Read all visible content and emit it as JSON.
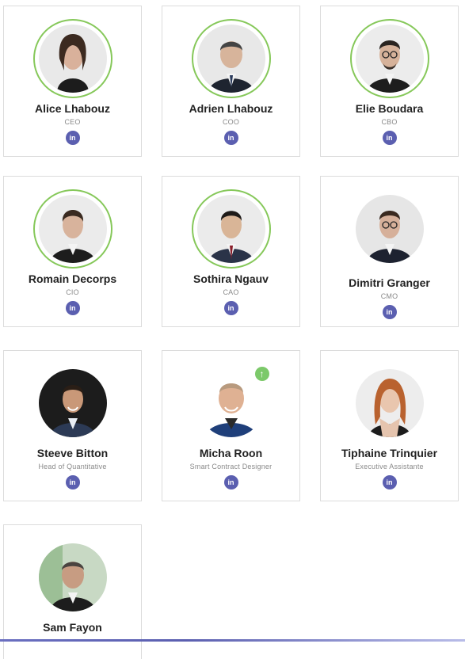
{
  "team": [
    {
      "name": "Alice Lhabouz",
      "role": "CEO",
      "linkedin": "in"
    },
    {
      "name": "Adrien Lhabouz",
      "role": "COO",
      "linkedin": "in"
    },
    {
      "name": "Elie Boudara",
      "role": "CBO",
      "linkedin": "in"
    },
    {
      "name": "Romain Decorps",
      "role": "CIO",
      "linkedin": "in"
    },
    {
      "name": "Sothira Ngauv",
      "role": "CAO",
      "linkedin": "in"
    },
    {
      "name": "Dimitri Granger",
      "role": "CMO",
      "linkedin": "in"
    },
    {
      "name": "Steeve Bitton",
      "role": "Head of Quantitative",
      "linkedin": "in"
    },
    {
      "name": "Micha Roon",
      "role": "Smart Contract Designer",
      "linkedin": "in",
      "badge": "↑"
    },
    {
      "name": "Tiphaine Trinquier",
      "role": "Executive Assistante",
      "linkedin": "in"
    },
    {
      "name": "Sam Fayon"
    }
  ],
  "colors": {
    "ring": "#86c85a",
    "linkedin": "#5b5fb0",
    "badge": "#7cc96a"
  },
  "icons": {
    "linkedin": "linkedin-icon",
    "upload": "upload-arrow-icon"
  }
}
